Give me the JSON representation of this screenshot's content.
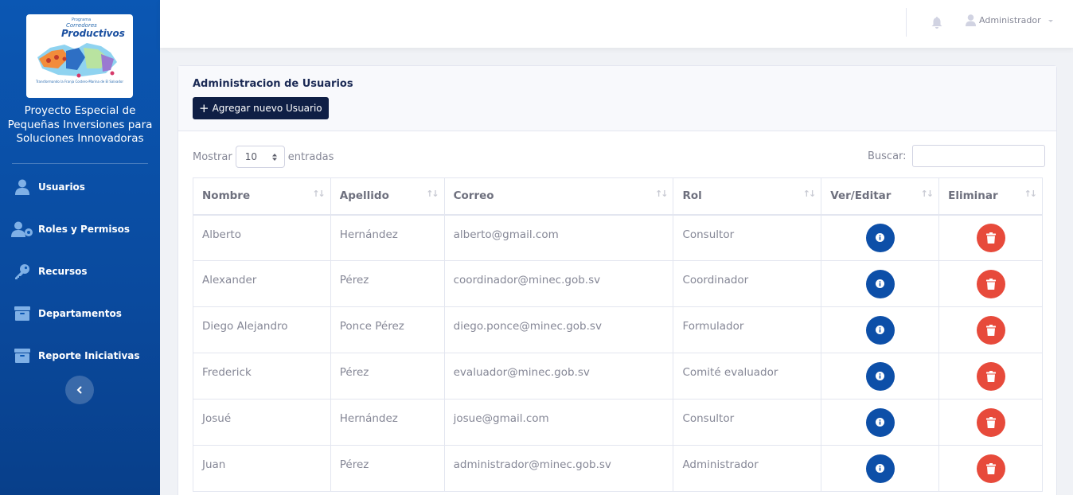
{
  "sidebar": {
    "logo": {
      "small": "Programa",
      "line1": "Corredores",
      "line2": "Productivos",
      "tagline": "Transformando la Franja Costero-Marina de El Salvador"
    },
    "org_name": "Proyecto Especial de Pequeñas Inversiones para Soluciones Innovadoras",
    "items": [
      {
        "label": "Usuarios",
        "icon": "user-icon"
      },
      {
        "label": "Roles y Permisos",
        "icon": "users-cog-icon"
      },
      {
        "label": "Recursos",
        "icon": "key-icon"
      },
      {
        "label": "Departamentos",
        "icon": "archive-icon"
      },
      {
        "label": "Reporte Iniciativas",
        "icon": "archive-icon"
      }
    ]
  },
  "topbar": {
    "user_name": "Administrador"
  },
  "page": {
    "title": "Administracion de Usuarios",
    "add_button": "Agregar nuevo Usuario",
    "length_prefix": "Mostrar",
    "length_value": "10",
    "length_suffix": "entradas",
    "search_label": "Buscar:",
    "search_value": ""
  },
  "table": {
    "headers": [
      "Nombre",
      "Apellido",
      "Correo",
      "Rol",
      "Ver/Editar",
      "Eliminar"
    ],
    "rows": [
      [
        "Alberto",
        "Hernández",
        "alberto@gmail.com",
        "Consultor"
      ],
      [
        "Alexander",
        "Pérez",
        "coordinador@minec.gob.sv",
        "Coordinador"
      ],
      [
        "Diego Alejandro",
        "Ponce Pérez",
        "diego.ponce@minec.gob.sv",
        "Formulador"
      ],
      [
        "Frederick",
        "Pérez",
        "evaluador@minec.gob.sv",
        "Comité evaluador"
      ],
      [
        "Josué",
        "Hernández",
        "josue@gmail.com",
        "Consultor"
      ],
      [
        "Juan",
        "Pérez",
        "administrador@minec.gob.sv",
        "Administrador"
      ]
    ]
  },
  "colors": {
    "sidebar": "#0b57b3",
    "primary_button": "#0f1f45",
    "info_button": "#0d4fa8",
    "delete_button": "#e74a3b"
  }
}
